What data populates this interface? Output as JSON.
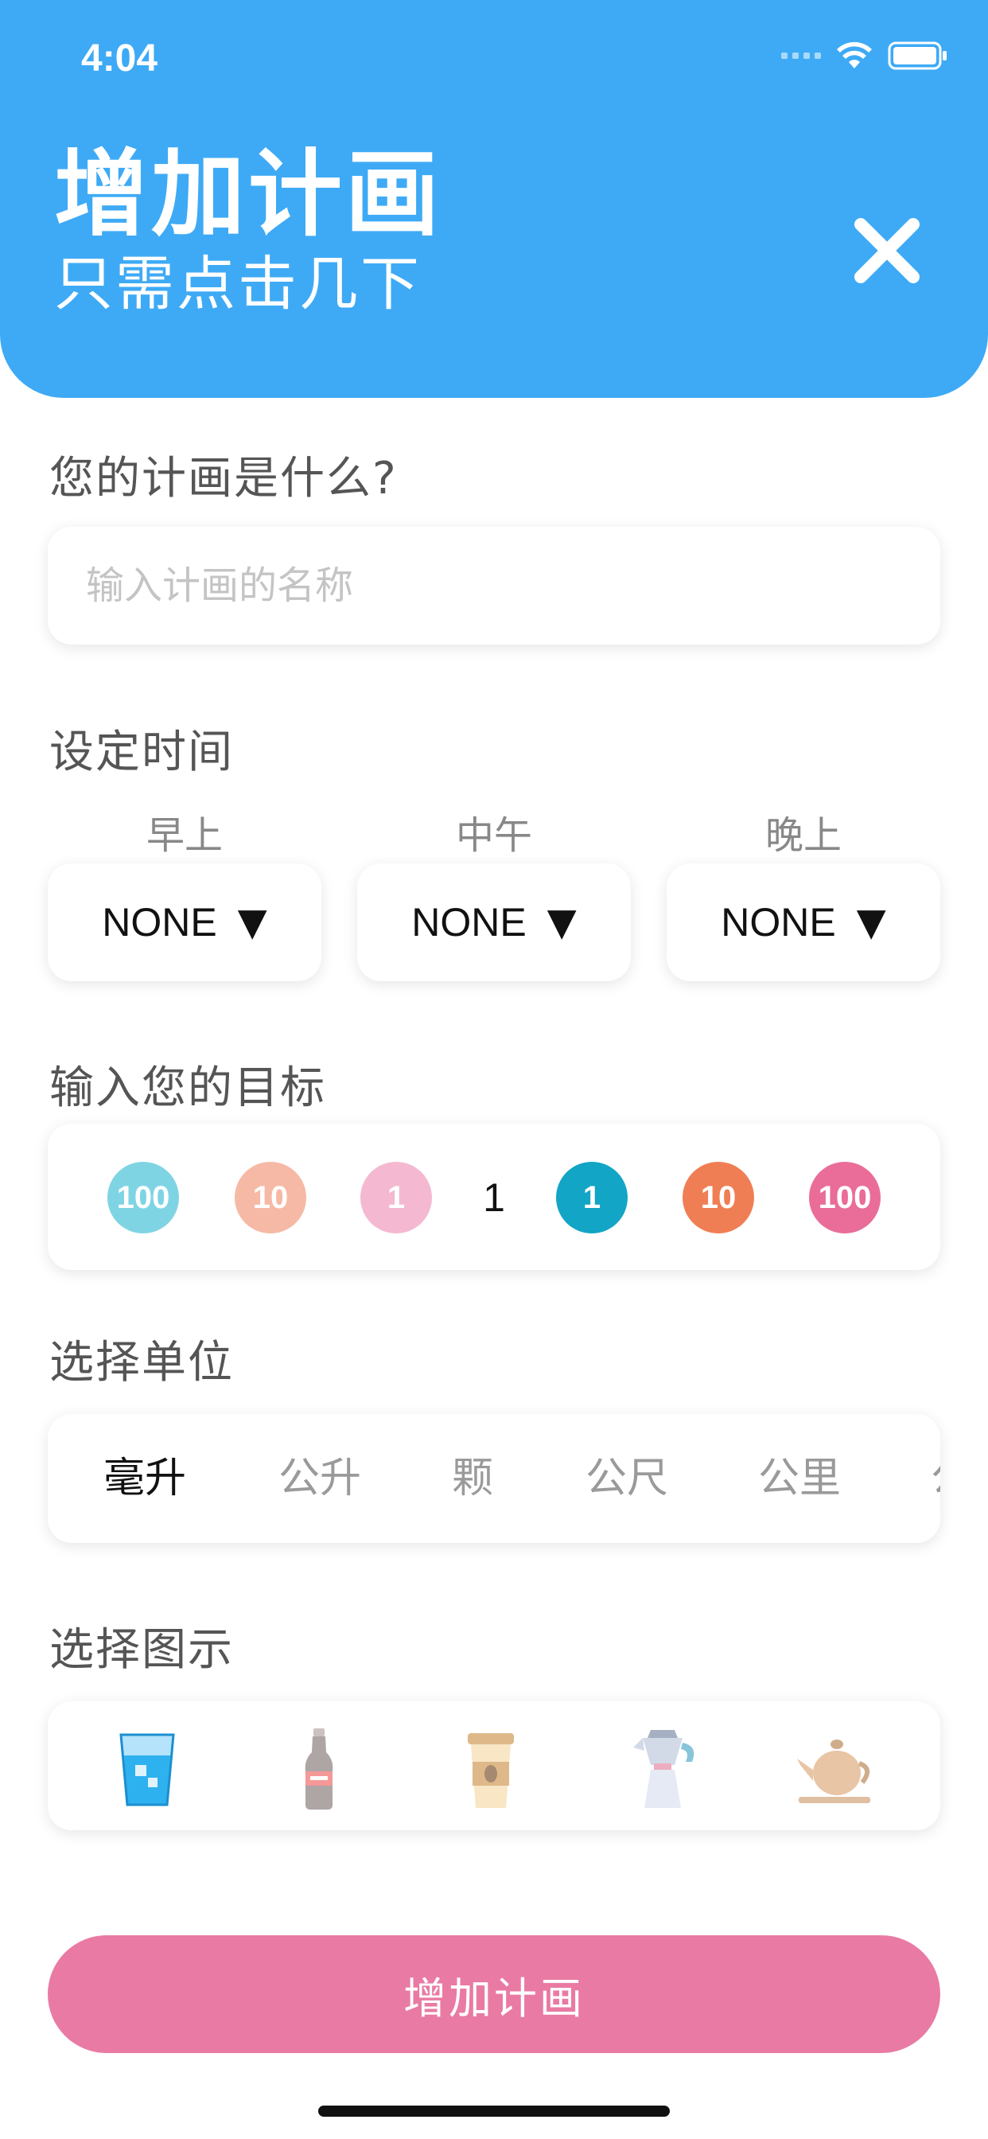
{
  "status_bar": {
    "time": "4:04"
  },
  "header": {
    "title": "增加计画",
    "subtitle": "只需点击几下",
    "close_icon": "close-icon",
    "background_color": "#3eaaf5"
  },
  "plan_name": {
    "label": "您的计画是什么?",
    "placeholder": "输入计画的名称",
    "value": ""
  },
  "schedule": {
    "label": "设定时间",
    "slots": [
      {
        "label": "早上",
        "value": "NONE",
        "arrow": "▼"
      },
      {
        "label": "中午",
        "value": "NONE",
        "arrow": "▼"
      },
      {
        "label": "晚上",
        "value": "NONE",
        "arrow": "▼"
      }
    ]
  },
  "goal": {
    "label": "输入您的目标",
    "decrease": [
      {
        "label": "100",
        "color": "#7fd4e4"
      },
      {
        "label": "10",
        "color": "#f6b9a5"
      },
      {
        "label": "1",
        "color": "#f4b9d0"
      }
    ],
    "value": "1",
    "increase": [
      {
        "label": "1",
        "color": "#12a5c5"
      },
      {
        "label": "10",
        "color": "#f07e55"
      },
      {
        "label": "100",
        "color": "#e96d98"
      }
    ]
  },
  "unit": {
    "label": "选择单位",
    "options": [
      "毫升",
      "公升",
      "颗",
      "公尺",
      "公里",
      "公"
    ],
    "selected": "毫升"
  },
  "icon_choice": {
    "label": "选择图示",
    "options": [
      "water-glass-icon",
      "cola-bottle-icon",
      "coffee-cup-icon",
      "moka-pot-icon",
      "teapot-icon"
    ]
  },
  "submit": {
    "label": "增加计画",
    "color": "#e97aa3"
  }
}
